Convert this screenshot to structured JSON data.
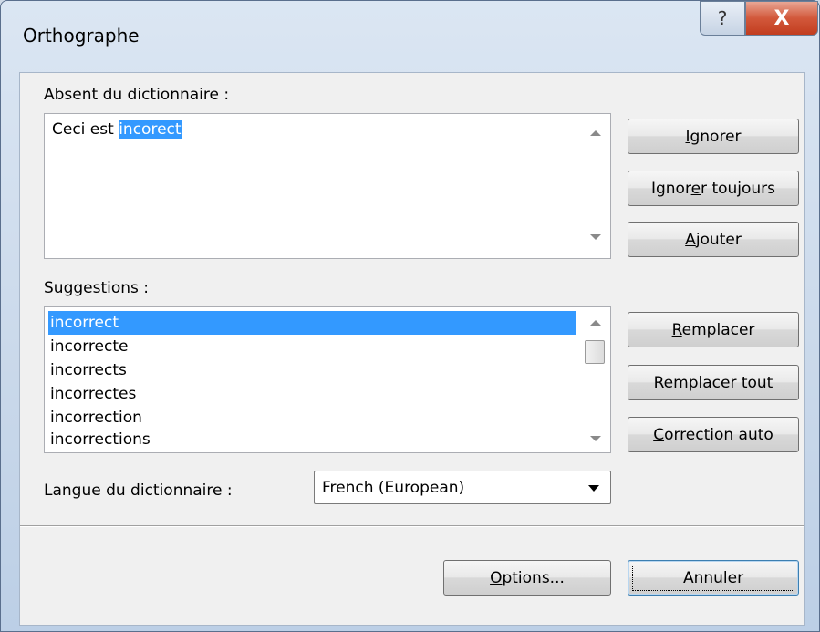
{
  "window": {
    "title": "Orthographe",
    "help_label": "?",
    "close_label": "X"
  },
  "not_in_dictionary": {
    "label": "Absent du dictionnaire :",
    "text_before": "Ceci est ",
    "text_highlight": "incorect"
  },
  "suggestions": {
    "label": "Suggestions :",
    "items": [
      "incorrect",
      "incorrecte",
      "incorrects",
      "incorrectes",
      "incorrection",
      "incorrections"
    ],
    "selected": "incorrect"
  },
  "dictionary_language": {
    "label": "Langue du dictionnaire :",
    "value": "French (European)"
  },
  "buttons": {
    "ignore": {
      "u": "I",
      "rest": "gnorer"
    },
    "ignore_all": {
      "pre": "Ignor",
      "u": "e",
      "rest": "r toujours"
    },
    "add": {
      "u": "A",
      "rest": "jouter"
    },
    "replace": {
      "u": "R",
      "rest": "emplacer"
    },
    "replace_all": {
      "pre": "Rem",
      "u": "p",
      "rest": "lacer tout"
    },
    "autocorrect": {
      "u": "C",
      "rest": "orrection auto"
    },
    "options": {
      "u": "O",
      "rest": "ptions..."
    },
    "cancel": "Annuler"
  }
}
